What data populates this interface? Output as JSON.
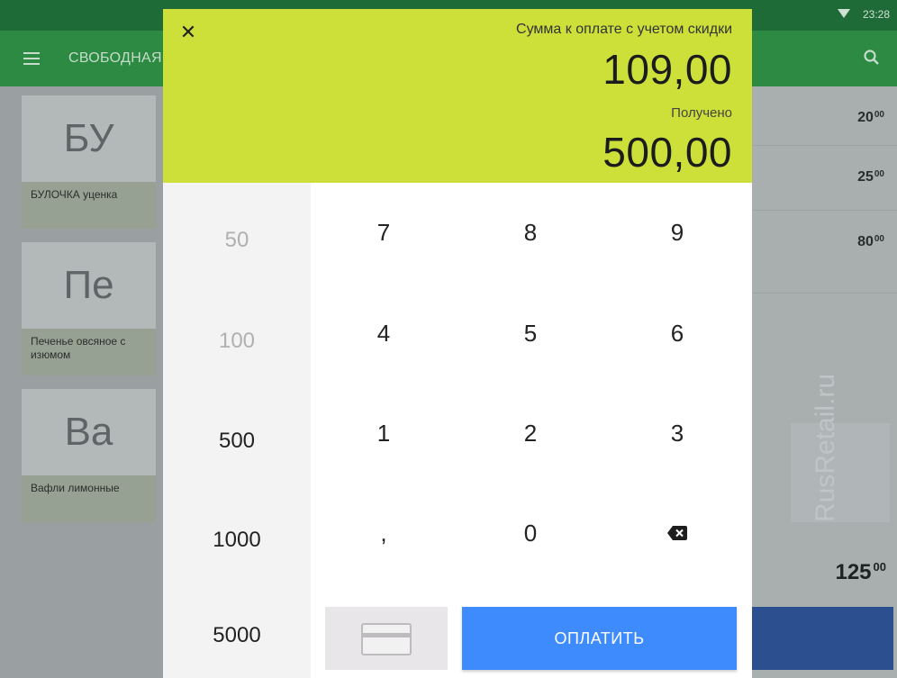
{
  "statusbar": {
    "time": "23:28",
    "icon": "wifi-icon"
  },
  "appbar": {
    "title": "СВОБОДНАЯ",
    "menu_icon": "menu-icon",
    "search_icon": "search-icon"
  },
  "products": [
    {
      "abbr": "БУ",
      "name": "БУЛОЧКА уценка"
    },
    {
      "abbr": "Пе",
      "name": "Печенье овсяное с изюмом"
    },
    {
      "abbr": "Ва",
      "name": "Вафли лимонные"
    }
  ],
  "cart": {
    "prices": [
      {
        "int": "20",
        "frac": "00"
      },
      {
        "int": "25",
        "frac": "00"
      },
      {
        "int": "80",
        "frac": "00"
      }
    ],
    "total": {
      "int": "125",
      "frac": "00"
    },
    "watermark": "RusRetail.ru"
  },
  "dialog": {
    "close_icon": "close-icon",
    "amount_label": "Сумма к оплате с учетом скидки",
    "amount_value": "109,00",
    "received_label": "Получено",
    "received_value": "500,00",
    "quick_amounts": [
      "50",
      "100",
      "500",
      "1000",
      "5000"
    ],
    "keys": [
      "7",
      "8",
      "9",
      "4",
      "5",
      "6",
      "1",
      "2",
      "3",
      ",",
      "0"
    ],
    "backspace_icon": "backspace-icon",
    "card_icon": "card-icon",
    "pay_label": "ОПЛАТИТЬ"
  },
  "colors": {
    "header": "#cde03a",
    "pay_button": "#3d8bfd",
    "appbar": "#2c8a43"
  }
}
